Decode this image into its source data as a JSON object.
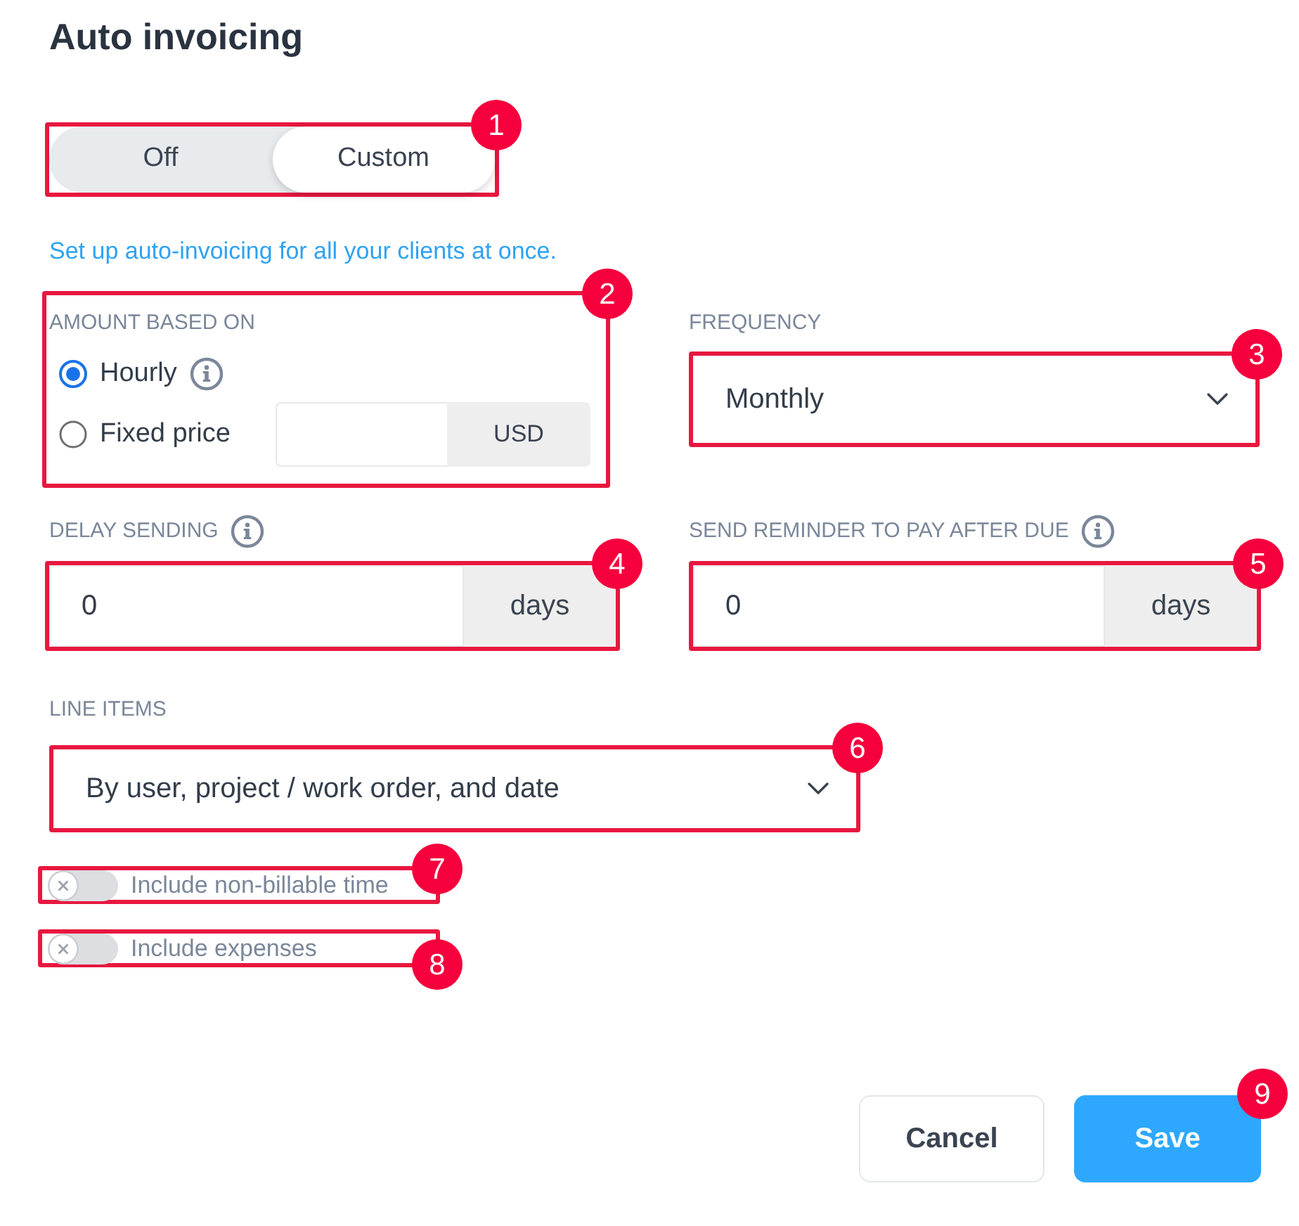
{
  "title": "Auto invoicing",
  "mode_switch": {
    "annotation": {
      "number": "1",
      "outline": true
    },
    "options": [
      {
        "label": "Off",
        "selected": false
      },
      {
        "label": "Custom",
        "selected": true
      }
    ]
  },
  "setup_link": "Set up auto-invoicing for all your clients at once.",
  "amount_based_on": {
    "annotation": {
      "number": "2",
      "outline": true
    },
    "label": "AMOUNT BASED ON",
    "options": [
      {
        "label": "Hourly",
        "selected": true,
        "info": true
      },
      {
        "label": "Fixed price",
        "selected": false,
        "currency": "USD"
      }
    ]
  },
  "frequency": {
    "annotation": {
      "number": "3",
      "outline": true
    },
    "label": "FREQUENCY",
    "value": "Monthly"
  },
  "delay_sending": {
    "annotation": {
      "number": "4",
      "outline": true
    },
    "label": "DELAY SENDING",
    "info": true,
    "value": "0",
    "unit": "days"
  },
  "reminder": {
    "annotation": {
      "number": "5",
      "outline": true
    },
    "label": "SEND REMINDER TO PAY AFTER DUE",
    "info": true,
    "value": "0",
    "unit": "days"
  },
  "line_items": {
    "annotation": {
      "number": "6",
      "outline": true
    },
    "label": "LINE ITEMS",
    "value": "By user, project / work order, and date"
  },
  "toggles": [
    {
      "annotation": {
        "number": "7",
        "outline": true
      },
      "label": "Include non-billable time",
      "on": false
    },
    {
      "annotation": {
        "number": "8",
        "outline": true,
        "badge_below": true
      },
      "label": "Include expenses",
      "on": false
    }
  ],
  "buttons": [
    {
      "label": "Cancel",
      "kind": "secondary"
    },
    {
      "label": "Save",
      "kind": "primary",
      "annotation": {
        "number": "9"
      }
    }
  ]
}
